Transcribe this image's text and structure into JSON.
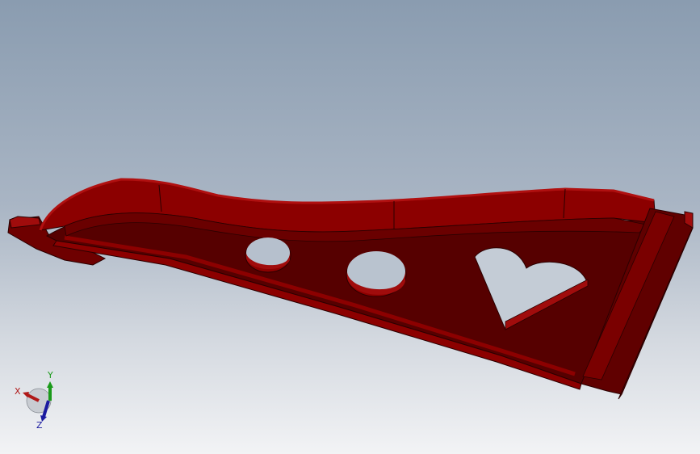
{
  "viewport": {
    "background_top": "#8a9cb0",
    "background_bottom": "#f2f3f5"
  },
  "model": {
    "part": "triangular-bracket-with-heart-cutout",
    "colors": {
      "top_face": "#560000",
      "wall": "#8c0000",
      "wall_shadow": "#6a0000",
      "edge": "#2a0000",
      "highlight": "#b01010"
    },
    "cutouts": [
      "small-circle-hole",
      "large-circle-hole",
      "heart-hole"
    ]
  },
  "triad": {
    "x_label": "X",
    "y_label": "Y",
    "z_label": "Z",
    "x_color": "#b01818",
    "y_color": "#1a9a1a",
    "z_color": "#1a1aa0"
  }
}
